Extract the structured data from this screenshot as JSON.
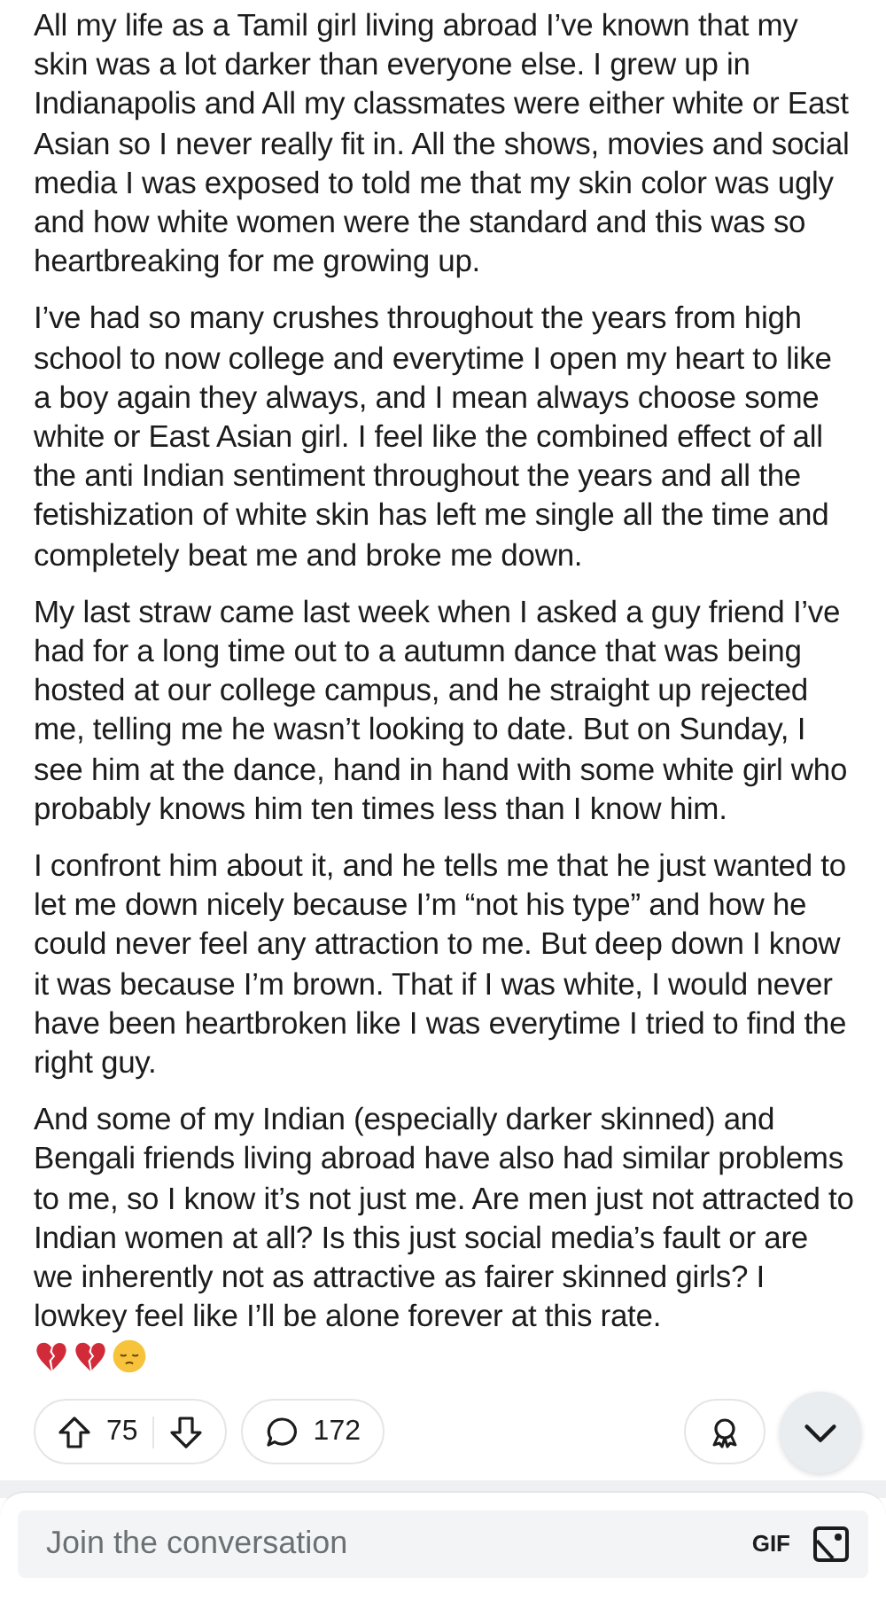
{
  "post": {
    "paragraphs": [
      "All my life as a Tamil girl living abroad I’ve known that my skin was a lot darker than everyone else. I grew up in Indianapolis and All my classmates were either white or East Asian so I never really fit in. All the shows, movies and social media I was exposed to told me that my skin color was ugly and how white women were the standard and this was so heartbreaking for me growing up.",
      "I’ve had so many crushes throughout the years from high school to now college and everytime I open my heart to like a boy again they always, and I mean always choose some white or East Asian girl. I feel like the combined effect of all the anti Indian sentiment throughout the years and all the fetishization of white skin has left me single all the time and completely beat me and broke me down.",
      "My last straw came last week when I asked a guy friend I’ve had for a long time out to a autumn dance that was being hosted at our college campus, and he straight up rejected me, telling me he wasn’t looking to date. But on Sunday, I see him at the dance, hand in hand with some white girl who probably knows him ten times less than I know him.",
      "I confront him about it, and he tells me that he just wanted to let me down nicely because I’m “not his type” and how he could never feel any attraction to me. But deep down I know it was because I’m brown. That if I was white, I would never have been heartbroken like I was everytime I tried to find the right guy.",
      "And some of my Indian (especially darker skinned) and Bengali friends living abroad have also had similar problems to me, so I know it’s not just me. Are men just not attracted to Indian women at all? Is this just social media’s fault or are we inherently not as attractive as fairer skinned girls? I lowkey feel like I’ll be alone forever at this rate."
    ],
    "trailing_emoji": [
      {
        "kind": "broken-heart"
      },
      {
        "kind": "broken-heart"
      },
      {
        "kind": "pensive-face"
      }
    ]
  },
  "actions": {
    "score": "75",
    "comments": "172"
  },
  "composer": {
    "placeholder": "Join the conversation",
    "gif": "GIF"
  }
}
